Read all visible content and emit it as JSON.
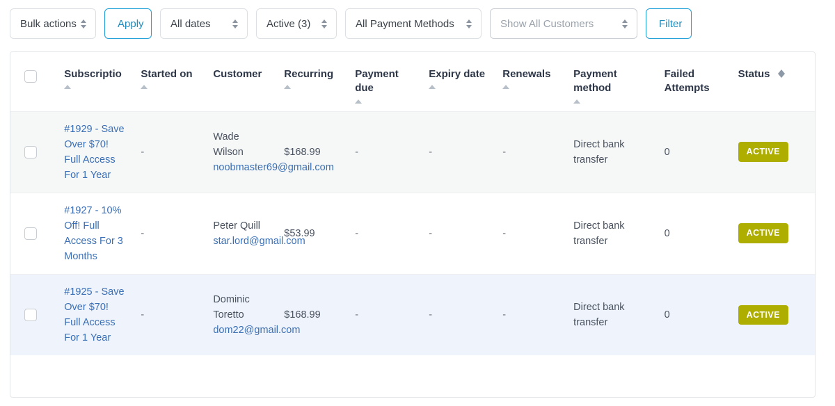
{
  "toolbar": {
    "bulk_actions": "Bulk actions",
    "apply_label": "Apply",
    "all_dates": "All dates",
    "status_filter": "Active (3)",
    "payment_methods": "All Payment Methods",
    "customers_placeholder": "Show All Customers",
    "filter_label": "Filter"
  },
  "table": {
    "headers": {
      "subscription": "Subscriptio",
      "started_on": "Started on",
      "customer": "Customer",
      "recurring": "Recurring",
      "payment_due": "Payment due",
      "expiry_date": "Expiry date",
      "renewals": "Renewals",
      "payment_method": "Payment method",
      "failed_attempts": "Failed Attempts",
      "status": "Status"
    },
    "rows": [
      {
        "subscription": "#1929 - Save Over $70! Full Access For 1 Year",
        "started_on": "-",
        "customer_name": "Wade Wilson",
        "customer_email": "noobmaster69@gmail.com",
        "recurring": "$168.99",
        "payment_due": "-",
        "expiry_date": "-",
        "renewals": "-",
        "payment_method": "Direct bank transfer",
        "failed_attempts": "0",
        "status": "ACTIVE"
      },
      {
        "subscription": "#1927 - 10% Off! Full Access For 3 Months",
        "started_on": "-",
        "customer_name": "Peter Quill",
        "customer_email": "star.lord@gmail.com",
        "recurring": "$53.99",
        "payment_due": "-",
        "expiry_date": "-",
        "renewals": "-",
        "payment_method": "Direct bank transfer",
        "failed_attempts": "0",
        "status": "ACTIVE"
      },
      {
        "subscription": "#1925 - Save Over $70! Full Access For 1 Year",
        "started_on": "-",
        "customer_name": "Dominic Toretto",
        "customer_email": "dom22@gmail.com",
        "recurring": "$168.99",
        "payment_due": "-",
        "expiry_date": "-",
        "renewals": "-",
        "payment_method": "Direct bank transfer",
        "failed_attempts": "0",
        "status": "ACTIVE"
      }
    ]
  },
  "colors": {
    "accent": "#1e9fd8",
    "link": "#3a6fb5",
    "status_badge": "#aeae00",
    "row_gray": "#f6f7f7",
    "row_blue": "#eff3fb"
  }
}
